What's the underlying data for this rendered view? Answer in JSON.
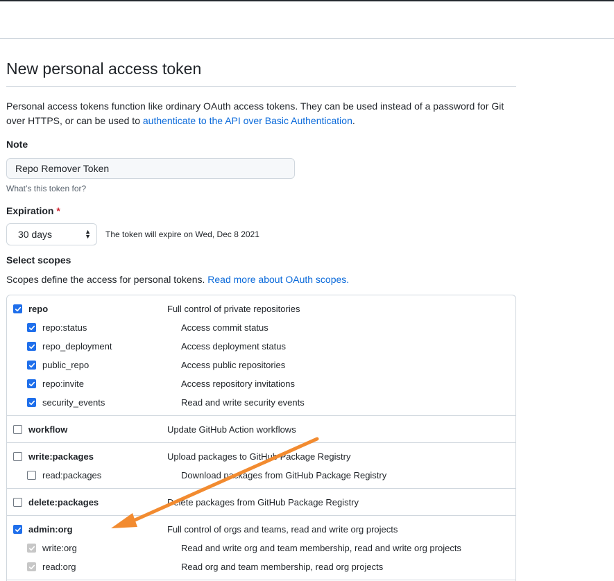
{
  "page": {
    "title": "New personal access token",
    "intro_text": "Personal access tokens function like ordinary OAuth access tokens. They can be used instead of a password for Git over HTTPS, or can be used to ",
    "intro_link": "authenticate to the API over Basic Authentication",
    "intro_end": "."
  },
  "note": {
    "label": "Note",
    "value": "Repo Remover Token",
    "hint": "What’s this token for?"
  },
  "expiration": {
    "label": "Expiration",
    "required_mark": "*",
    "selected": "30 days",
    "note": "The token will expire on Wed, Dec 8 2021"
  },
  "scopes": {
    "title": "Select scopes",
    "desc": "Scopes define the access for personal tokens. ",
    "desc_link": "Read more about OAuth scopes.",
    "groups": [
      {
        "parent": {
          "name": "repo",
          "desc": "Full control of private repositories",
          "state": "checked"
        },
        "children": [
          {
            "name": "repo:status",
            "desc": "Access commit status",
            "state": "checked"
          },
          {
            "name": "repo_deployment",
            "desc": "Access deployment status",
            "state": "checked"
          },
          {
            "name": "public_repo",
            "desc": "Access public repositories",
            "state": "checked"
          },
          {
            "name": "repo:invite",
            "desc": "Access repository invitations",
            "state": "checked"
          },
          {
            "name": "security_events",
            "desc": "Read and write security events",
            "state": "checked"
          }
        ]
      },
      {
        "parent": {
          "name": "workflow",
          "desc": "Update GitHub Action workflows",
          "state": "unchecked"
        },
        "children": []
      },
      {
        "parent": {
          "name": "write:packages",
          "desc": "Upload packages to GitHub Package Registry",
          "state": "unchecked"
        },
        "children": [
          {
            "name": "read:packages",
            "desc": "Download packages from GitHub Package Registry",
            "state": "unchecked"
          }
        ]
      },
      {
        "parent": {
          "name": "delete:packages",
          "desc": "Delete packages from GitHub Package Registry",
          "state": "unchecked"
        },
        "children": []
      },
      {
        "parent": {
          "name": "admin:org",
          "desc": "Full control of orgs and teams, read and write org projects",
          "state": "checked"
        },
        "children": [
          {
            "name": "write:org",
            "desc": "Read and write org and team membership, read and write org projects",
            "state": "disabled-checked"
          },
          {
            "name": "read:org",
            "desc": "Read org and team membership, read org projects",
            "state": "disabled-checked"
          }
        ]
      }
    ]
  },
  "colors": {
    "accent": "#0969da",
    "checkbox": "#1f6feb",
    "annotation_arrow": "#f28b30",
    "required": "#cf222e"
  }
}
